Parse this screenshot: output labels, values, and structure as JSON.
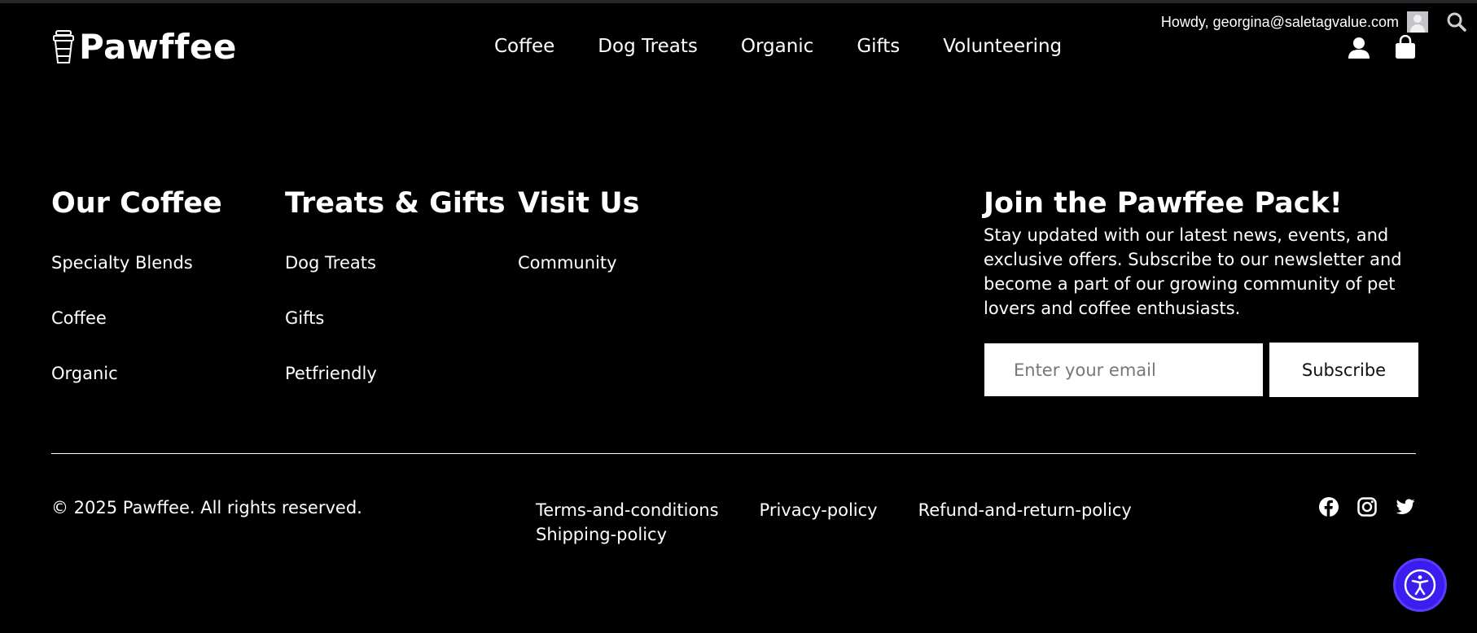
{
  "colors": {
    "background": "#000000",
    "text": "#ffffff",
    "accessibility_button": "#3c1df0"
  },
  "admin_bar": {
    "greeting": "Howdy, georgina@saletagvalue.com",
    "avatar_icon": "avatar-icon",
    "search_icon": "search-icon"
  },
  "header": {
    "logo_text": "Pawffee",
    "logo_icon": "coffee-cup-icon",
    "nav": [
      "Coffee",
      "Dog Treats",
      "Organic",
      "Gifts",
      "Volunteering"
    ],
    "user_icon": "user-icon",
    "cart_icon": "shopping-bag-icon"
  },
  "footer": {
    "columns": [
      {
        "title": "Our Coffee",
        "links": [
          "Specialty Blends",
          "Coffee",
          "Organic"
        ]
      },
      {
        "title": "Treats & Gifts",
        "links": [
          "Dog Treats",
          "Gifts",
          "Petfriendly"
        ]
      },
      {
        "title": "Visit Us",
        "links": [
          "Community"
        ]
      }
    ],
    "newsletter": {
      "title": "Join the Pawffee Pack!",
      "description": "Stay updated with our latest news, events, and exclusive offers. Subscribe to our newsletter and become a part of our growing community of pet lovers and coffee enthusiasts.",
      "email_placeholder": "Enter your email",
      "email_value": "",
      "subscribe_label": "Subscribe"
    },
    "copyright": "© 2025 Pawffee. All rights reserved.",
    "policies": [
      "Terms-and-conditions",
      "Privacy-policy",
      "Refund-and-return-policy",
      "Shipping-policy"
    ],
    "social_icons": [
      "facebook-icon",
      "instagram-icon",
      "twitter-icon"
    ]
  },
  "accessibility_widget": {
    "icon": "accessibility-icon"
  }
}
